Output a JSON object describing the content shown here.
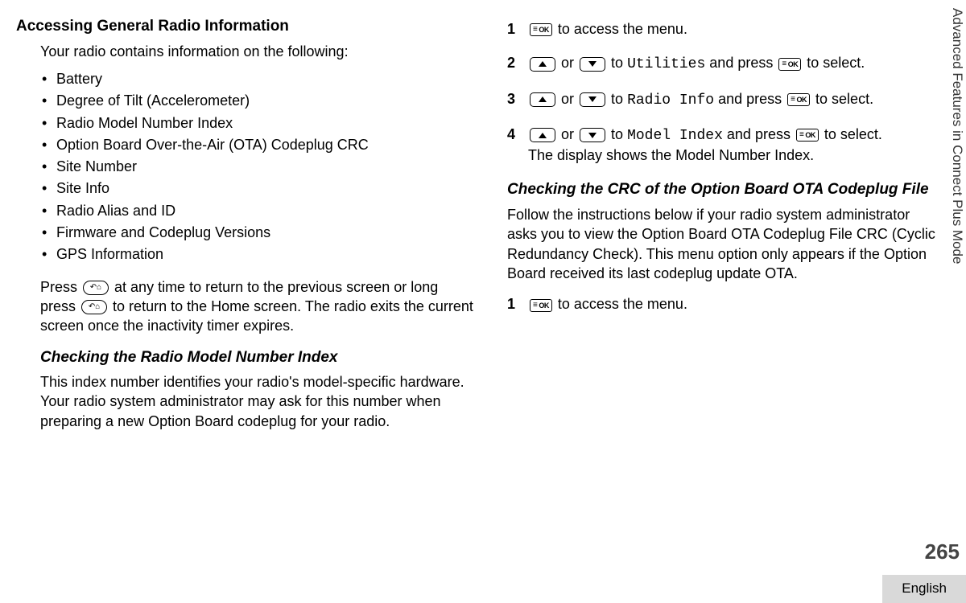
{
  "side_tab": "Advanced Features in Connect Plus Mode",
  "page_num": "265",
  "lang": "English",
  "left": {
    "h1": "Accessing General Radio Information",
    "intro": "Your radio contains information on the following:",
    "bullets": [
      "Battery",
      "Degree of Tilt (Accelerometer)",
      "Radio Model Number Index",
      "Option Board Over-the-Air (OTA) Codeplug CRC",
      "Site Number",
      "Site Info",
      "Radio Alias and ID",
      "Firmware and Codeplug Versions",
      "GPS Information"
    ],
    "press_a": "Press ",
    "press_b": " at any time to return to the previous screen or long press ",
    "press_c": " to return to the Home screen. The radio exits the current screen once the inactivity timer expires.",
    "h2": "Checking the Radio Model Number Index",
    "para2": "This index number identifies your radio's model-specific hardware. Your radio system administrator may ask for this number when preparing a new Option Board codeplug for your radio."
  },
  "right": {
    "steps": [
      {
        "n": "1",
        "access": " to access the menu."
      },
      {
        "n": "2",
        "or": " or ",
        "to": " to ",
        "t1": "Utilities",
        "and": " and press ",
        "sel": " to select."
      },
      {
        "n": "3",
        "or": " or ",
        "to": " to ",
        "t1": "Radio Info",
        "and": " and press ",
        "sel": " to select."
      },
      {
        "n": "4",
        "or": " or ",
        "to": " to ",
        "t1": "Model Index",
        "and": " and press ",
        "sel": " to select.",
        "extra": "The display shows the Model Number Index."
      }
    ],
    "h2": "Checking the CRC of the Option Board OTA Codeplug File",
    "para": "Follow the instructions below if your radio system administrator asks you to view the Option Board OTA Codeplug File CRC (Cyclic Redundancy Check). This menu option only appears if the Option Board received its last codeplug update OTA.",
    "step1n": "1",
    "step1t": " to access the menu."
  },
  "ok_label": "OK"
}
